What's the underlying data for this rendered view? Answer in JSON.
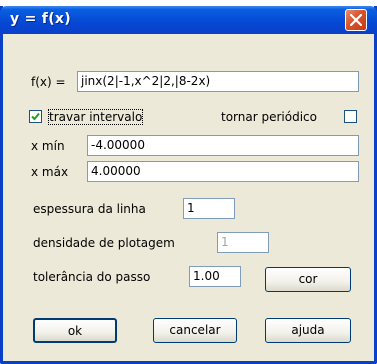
{
  "window": {
    "title": "y = f(x)"
  },
  "icons": {
    "close": "close-icon",
    "check": "check-icon"
  },
  "colors": {
    "titlebar": "#0548d4",
    "close": "#d9532a",
    "dialog": "#ece9d8"
  },
  "form": {
    "function_label": "f(x) =",
    "function_value": "jinx(2|-1,x^2|2,|8-2x)",
    "lock_interval_label": "travar intervalo",
    "lock_interval_checked": true,
    "periodic_label": "tornar periódico",
    "periodic_checked": false,
    "xmin_label": "x mín",
    "xmin_value": "-4.00000",
    "xmax_label": "x máx",
    "xmax_value": "4.00000",
    "line_width_label": "espessura da linha",
    "line_width_value": "1",
    "plot_density_label": "densidade de plotagem",
    "plot_density_value": "1",
    "step_tolerance_label": "tolerância do passo",
    "step_tolerance_value": "1.00"
  },
  "buttons": {
    "color": "cor",
    "ok": "ok",
    "cancel": "cancelar",
    "help": "ajuda"
  }
}
